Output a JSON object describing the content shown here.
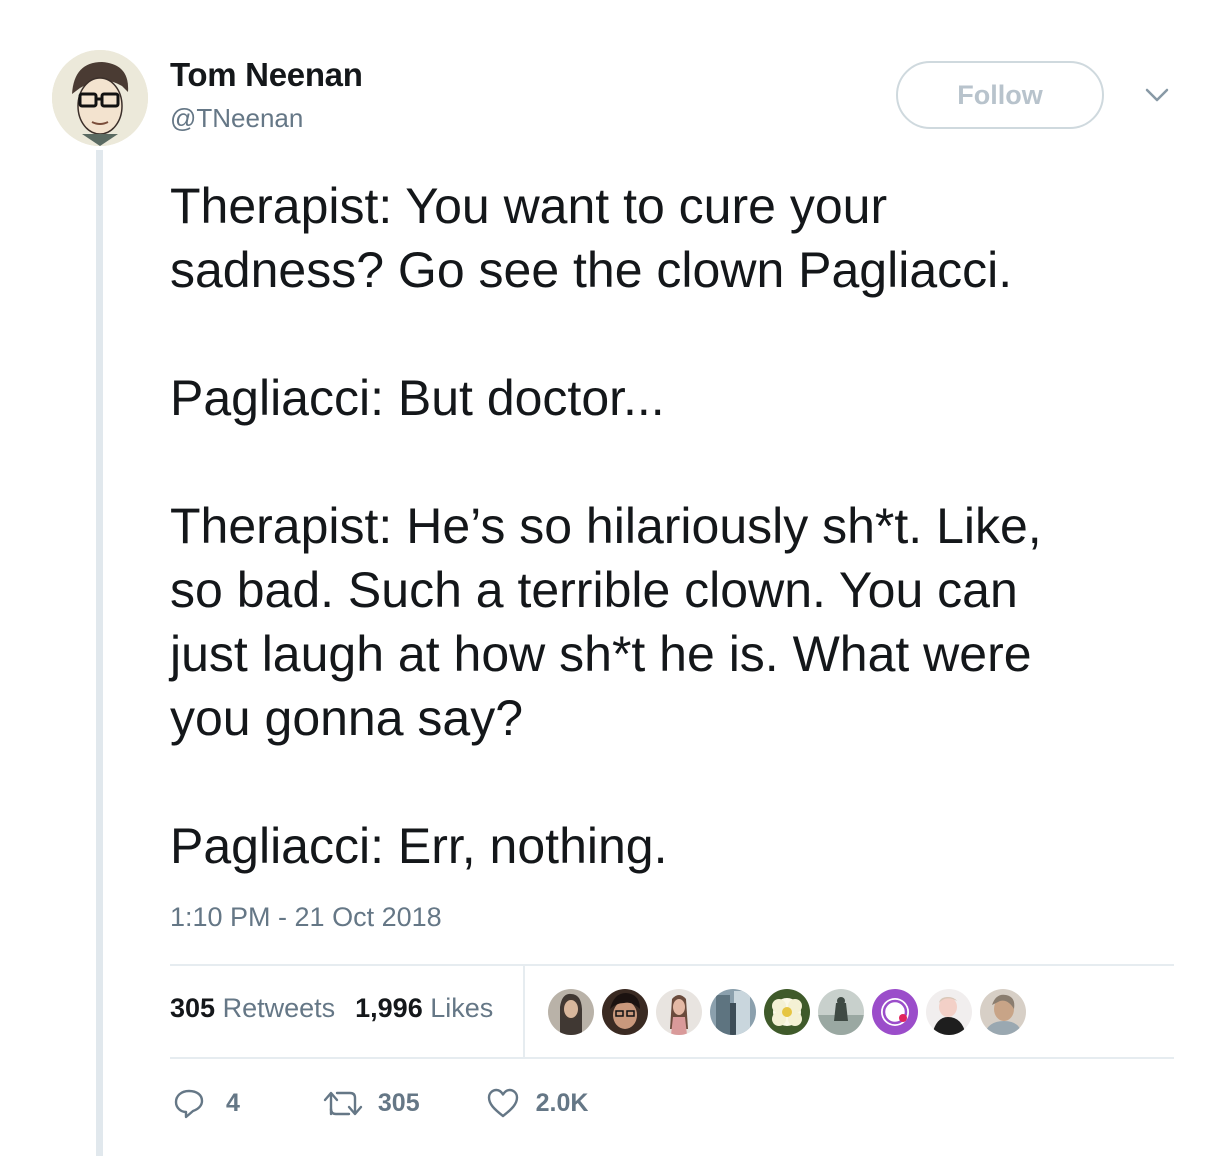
{
  "author": {
    "name": "Tom Neenan",
    "handle": "@TNeenan",
    "avatar_icon": "cartoon-avatar-icon"
  },
  "follow_label": "Follow",
  "menu_icon": "chevron-down-icon",
  "tweet": {
    "lines": [
      "Therapist: You want to cure your",
      "sadness? Go see the clown Pagliacci.",
      "",
      "Pagliacci: But doctor...",
      "",
      "Therapist: He’s so hilariously sh*t. Like,",
      "so bad. Such a terrible clown. You can",
      "just laugh at how sh*t he is. What were",
      "you gonna say?",
      "",
      "Pagliacci: Err, nothing."
    ],
    "timestamp": "1:10 PM - 21 Oct 2018"
  },
  "stats": {
    "retweets_count": "305",
    "retweets_label": "Retweets",
    "likes_count": "1,996",
    "likes_label": "Likes"
  },
  "likers_count_shown": 9,
  "actions": {
    "reply_count": "4",
    "retweet_count": "305",
    "like_count": "2.0K"
  },
  "colors": {
    "text": "#14171a",
    "secondary": "#657786",
    "border": "#e6ecf0",
    "follow_border": "#cfd9de",
    "liker_purple": "#9b4dca"
  }
}
